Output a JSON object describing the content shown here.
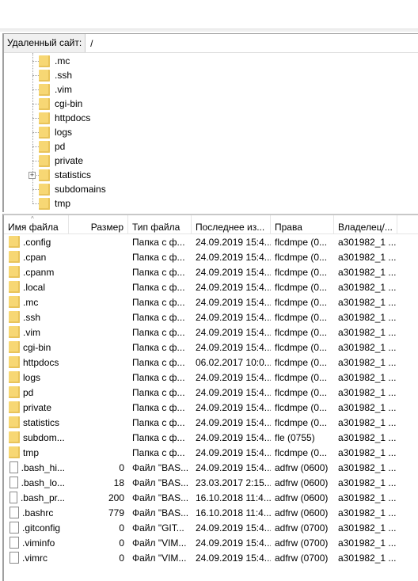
{
  "remote": {
    "label": "Удаленный сайт:",
    "path": "/"
  },
  "tree": [
    {
      "name": ".mc"
    },
    {
      "name": ".ssh"
    },
    {
      "name": ".vim"
    },
    {
      "name": "cgi-bin"
    },
    {
      "name": "httpdocs"
    },
    {
      "name": "logs"
    },
    {
      "name": "pd"
    },
    {
      "name": "private"
    },
    {
      "name": "statistics",
      "expandable": true
    },
    {
      "name": "subdomains"
    },
    {
      "name": "tmp"
    }
  ],
  "columns": [
    "Имя файла",
    "Размер",
    "Тип файла",
    "Последнее из...",
    "Права",
    "Владелец/..."
  ],
  "files": [
    {
      "name": ".config",
      "size": "",
      "type": "Папка с ф...",
      "modified": "24.09.2019 15:4...",
      "rights": "flcdmpe (0...",
      "owner": "a301982_1 ...",
      "icon": "folder"
    },
    {
      "name": ".cpan",
      "size": "",
      "type": "Папка с ф...",
      "modified": "24.09.2019 15:4...",
      "rights": "flcdmpe (0...",
      "owner": "a301982_1 ...",
      "icon": "folder"
    },
    {
      "name": ".cpanm",
      "size": "",
      "type": "Папка с ф...",
      "modified": "24.09.2019 15:4...",
      "rights": "flcdmpe (0...",
      "owner": "a301982_1 ...",
      "icon": "folder"
    },
    {
      "name": ".local",
      "size": "",
      "type": "Папка с ф...",
      "modified": "24.09.2019 15:4...",
      "rights": "flcdmpe (0...",
      "owner": "a301982_1 ...",
      "icon": "folder"
    },
    {
      "name": ".mc",
      "size": "",
      "type": "Папка с ф...",
      "modified": "24.09.2019 15:4...",
      "rights": "flcdmpe (0...",
      "owner": "a301982_1 ...",
      "icon": "folder"
    },
    {
      "name": ".ssh",
      "size": "",
      "type": "Папка с ф...",
      "modified": "24.09.2019 15:4...",
      "rights": "flcdmpe (0...",
      "owner": "a301982_1 ...",
      "icon": "folder"
    },
    {
      "name": ".vim",
      "size": "",
      "type": "Папка с ф...",
      "modified": "24.09.2019 15:4...",
      "rights": "flcdmpe (0...",
      "owner": "a301982_1 ...",
      "icon": "folder"
    },
    {
      "name": "cgi-bin",
      "size": "",
      "type": "Папка с ф...",
      "modified": "24.09.2019 15:4...",
      "rights": "flcdmpe (0...",
      "owner": "a301982_1 ...",
      "icon": "folder"
    },
    {
      "name": "httpdocs",
      "size": "",
      "type": "Папка с ф...",
      "modified": "06.02.2017 10:0...",
      "rights": "flcdmpe (0...",
      "owner": "a301982_1 ...",
      "icon": "folder"
    },
    {
      "name": "logs",
      "size": "",
      "type": "Папка с ф...",
      "modified": "24.09.2019 15:4...",
      "rights": "flcdmpe (0...",
      "owner": "a301982_1 ...",
      "icon": "folder"
    },
    {
      "name": "pd",
      "size": "",
      "type": "Папка с ф...",
      "modified": "24.09.2019 15:4...",
      "rights": "flcdmpe (0...",
      "owner": "a301982_1 ...",
      "icon": "folder"
    },
    {
      "name": "private",
      "size": "",
      "type": "Папка с ф...",
      "modified": "24.09.2019 15:4...",
      "rights": "flcdmpe (0...",
      "owner": "a301982_1 ...",
      "icon": "folder"
    },
    {
      "name": "statistics",
      "size": "",
      "type": "Папка с ф...",
      "modified": "24.09.2019 15:4...",
      "rights": "flcdmpe (0...",
      "owner": "a301982_1 ...",
      "icon": "folder"
    },
    {
      "name": "subdom...",
      "size": "",
      "type": "Папка с ф...",
      "modified": "24.09.2019 15:4...",
      "rights": "fle (0755)",
      "owner": "a301982_1 ...",
      "icon": "folder"
    },
    {
      "name": "tmp",
      "size": "",
      "type": "Папка с ф...",
      "modified": "24.09.2019 15:4...",
      "rights": "flcdmpe (0...",
      "owner": "a301982_1 ...",
      "icon": "folder"
    },
    {
      "name": ".bash_hi...",
      "size": "0",
      "type": "Файл \"BAS...",
      "modified": "24.09.2019 15:4...",
      "rights": "adfrw (0600)",
      "owner": "a301982_1 ...",
      "icon": "file"
    },
    {
      "name": ".bash_lo...",
      "size": "18",
      "type": "Файл \"BAS...",
      "modified": "23.03.2017 2:15...",
      "rights": "adfrw (0600)",
      "owner": "a301982_1 ...",
      "icon": "file"
    },
    {
      "name": ".bash_pr...",
      "size": "200",
      "type": "Файл \"BAS...",
      "modified": "16.10.2018 11:4...",
      "rights": "adfrw (0600)",
      "owner": "a301982_1 ...",
      "icon": "file"
    },
    {
      "name": ".bashrc",
      "size": "779",
      "type": "Файл \"BAS...",
      "modified": "16.10.2018 11:4...",
      "rights": "adfrw (0600)",
      "owner": "a301982_1 ...",
      "icon": "file"
    },
    {
      "name": ".gitconfig",
      "size": "0",
      "type": "Файл \"GIT...",
      "modified": "24.09.2019 15:4...",
      "rights": "adfrw (0700)",
      "owner": "a301982_1 ...",
      "icon": "file"
    },
    {
      "name": ".viminfo",
      "size": "0",
      "type": "Файл \"VIM...",
      "modified": "24.09.2019 15:4...",
      "rights": "adfrw (0700)",
      "owner": "a301982_1 ...",
      "icon": "file"
    },
    {
      "name": ".vimrc",
      "size": "0",
      "type": "Файл \"VIM...",
      "modified": "24.09.2019 15:4...",
      "rights": "adfrw (0700)",
      "owner": "a301982_1 ...",
      "icon": "file"
    }
  ],
  "colors": {
    "folder": "#f7d774",
    "border": "#a0a0a0"
  }
}
